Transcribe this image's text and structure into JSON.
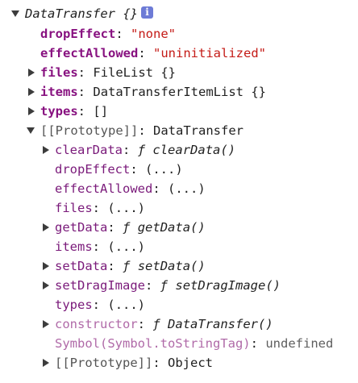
{
  "root": {
    "label": "DataTransfer",
    "suffix": "{}",
    "info": "i"
  },
  "own_props": [
    {
      "key": "dropEffect",
      "value": "\"none\""
    },
    {
      "key": "effectAllowed",
      "value": "\"uninitialized\""
    }
  ],
  "collapsed_props": [
    {
      "key": "files",
      "value": "FileList {}"
    },
    {
      "key": "items",
      "value": "DataTransferItemList {}"
    },
    {
      "key": "types",
      "value": "[]"
    }
  ],
  "prototype": {
    "label": "[[Prototype]]",
    "value": "DataTransfer",
    "members": [
      {
        "key": "clearData",
        "fnmark": "ƒ",
        "value": "clearData()"
      },
      {
        "key": "dropEffect",
        "value": "(...)"
      },
      {
        "key": "effectAllowed",
        "value": "(...)"
      },
      {
        "key": "files",
        "value": "(...)"
      },
      {
        "key": "getData",
        "fnmark": "ƒ",
        "value": "getData()"
      },
      {
        "key": "items",
        "value": "(...)"
      },
      {
        "key": "setData",
        "fnmark": "ƒ",
        "value": "setData()"
      },
      {
        "key": "setDragImage",
        "fnmark": "ƒ",
        "value": "setDragImage()"
      },
      {
        "key": "types",
        "value": "(...)"
      },
      {
        "key": "constructor",
        "fnmark": "ƒ",
        "value": "DataTransfer()"
      },
      {
        "key": "Symbol(Symbol.toStringTag)",
        "value": "undefined"
      },
      {
        "key": "[[Prototype]]",
        "value": "Object"
      }
    ]
  },
  "punct": {
    "colon": ":"
  }
}
